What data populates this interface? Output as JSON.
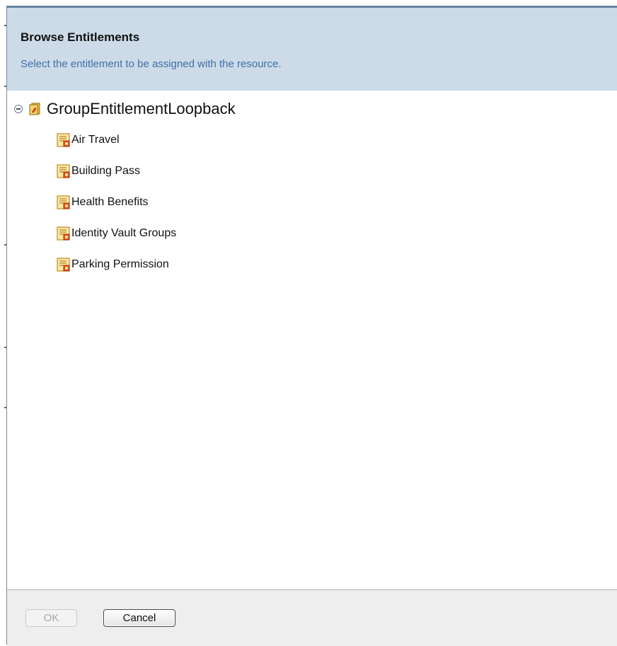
{
  "dialog": {
    "title": "Browse Entitlements",
    "subtitle": "Select the entitlement to be assigned with the resource."
  },
  "tree": {
    "root": {
      "label": "GroupEntitlementLoopback",
      "expanded": true,
      "icon": "driver-book-icon"
    },
    "items": [
      {
        "label": "Air Travel",
        "icon": "entitlement-icon"
      },
      {
        "label": "Building Pass",
        "icon": "entitlement-icon"
      },
      {
        "label": "Health Benefits",
        "icon": "entitlement-icon"
      },
      {
        "label": "Identity Vault Groups",
        "icon": "entitlement-icon"
      },
      {
        "label": "Parking Permission",
        "icon": "entitlement-icon"
      }
    ]
  },
  "footer": {
    "ok_label": "OK",
    "ok_enabled": false,
    "cancel_label": "Cancel"
  },
  "colors": {
    "header_bg": "#cddbe8",
    "subtitle": "#3e6fa8",
    "footer_bg": "#eeeeee"
  }
}
